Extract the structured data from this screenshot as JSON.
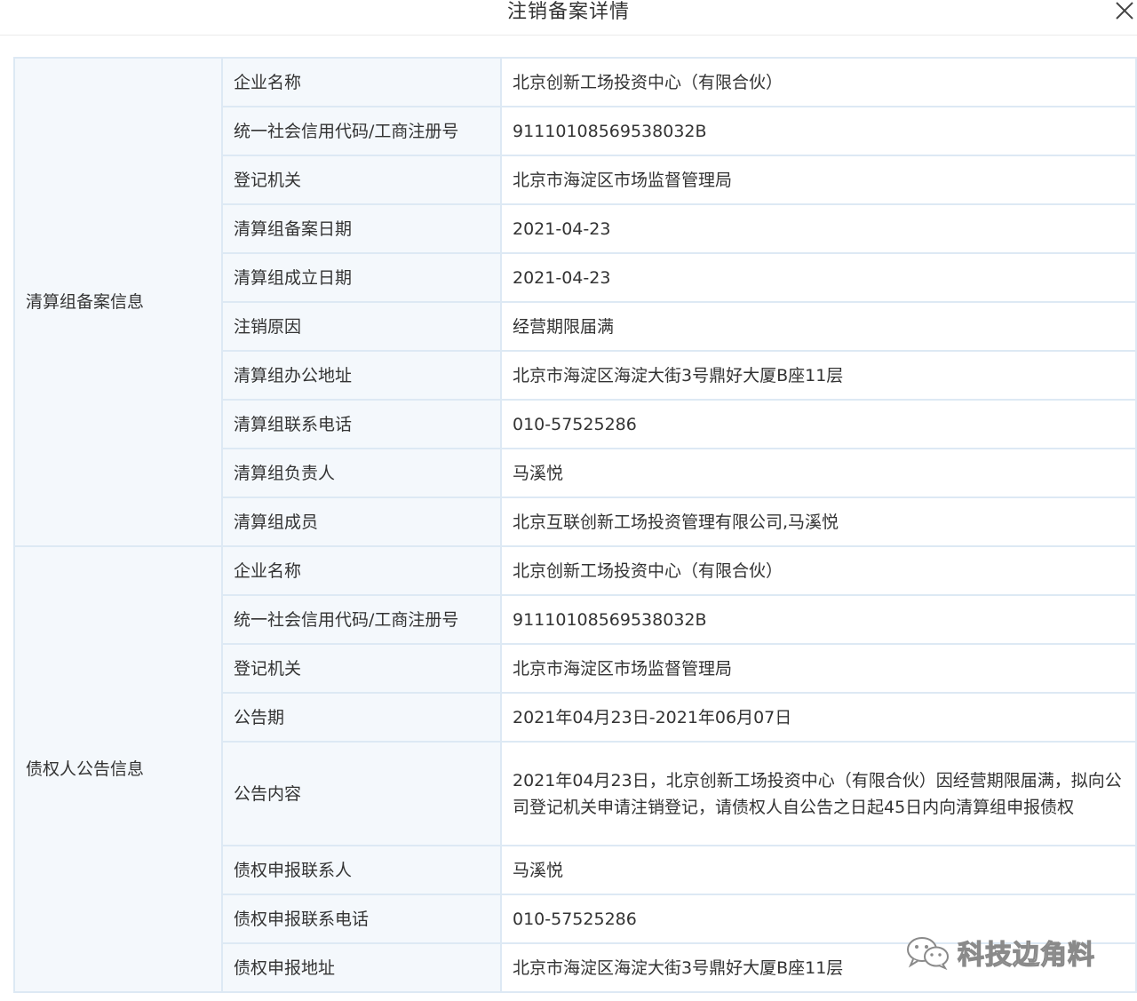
{
  "dialog": {
    "title": "注销备案详情"
  },
  "sections": [
    {
      "name": "清算组备案信息",
      "rows": [
        {
          "label": "企业名称",
          "value": "北京创新工场投资中心（有限合伙）"
        },
        {
          "label": "统一社会信用代码/工商注册号",
          "value": "91110108569538032B"
        },
        {
          "label": "登记机关",
          "value": "北京市海淀区市场监督管理局"
        },
        {
          "label": "清算组备案日期",
          "value": "2021-04-23"
        },
        {
          "label": "清算组成立日期",
          "value": "2021-04-23"
        },
        {
          "label": "注销原因",
          "value": "经营期限届满"
        },
        {
          "label": "清算组办公地址",
          "value": "北京市海淀区海淀大街3号鼎好大厦B座11层"
        },
        {
          "label": "清算组联系电话",
          "value": "010-57525286"
        },
        {
          "label": "清算组负责人",
          "value": "马溪悦"
        },
        {
          "label": "清算组成员",
          "value": "北京互联创新工场投资管理有限公司,马溪悦"
        }
      ]
    },
    {
      "name": "债权人公告信息",
      "rows": [
        {
          "label": "企业名称",
          "value": "北京创新工场投资中心（有限合伙）"
        },
        {
          "label": "统一社会信用代码/工商注册号",
          "value": "91110108569538032B"
        },
        {
          "label": "登记机关",
          "value": "北京市海淀区市场监督管理局"
        },
        {
          "label": "公告期",
          "value": "2021年04月23日-2021年06月07日"
        },
        {
          "label": "公告内容",
          "value": "2021年04月23日，北京创新工场投资中心（有限合伙）因经营期限届满，拟向公司登记机关申请注销登记，请债权人自公告之日起45日内向清算组申报债权"
        },
        {
          "label": "债权申报联系人",
          "value": "马溪悦"
        },
        {
          "label": "债权申报联系电话",
          "value": "010-57525286"
        },
        {
          "label": "债权申报地址",
          "value": "北京市海淀区海淀大街3号鼎好大厦B座11层"
        }
      ]
    }
  ],
  "watermark": {
    "text": "科技边角料",
    "icon": "wechat-icon"
  }
}
